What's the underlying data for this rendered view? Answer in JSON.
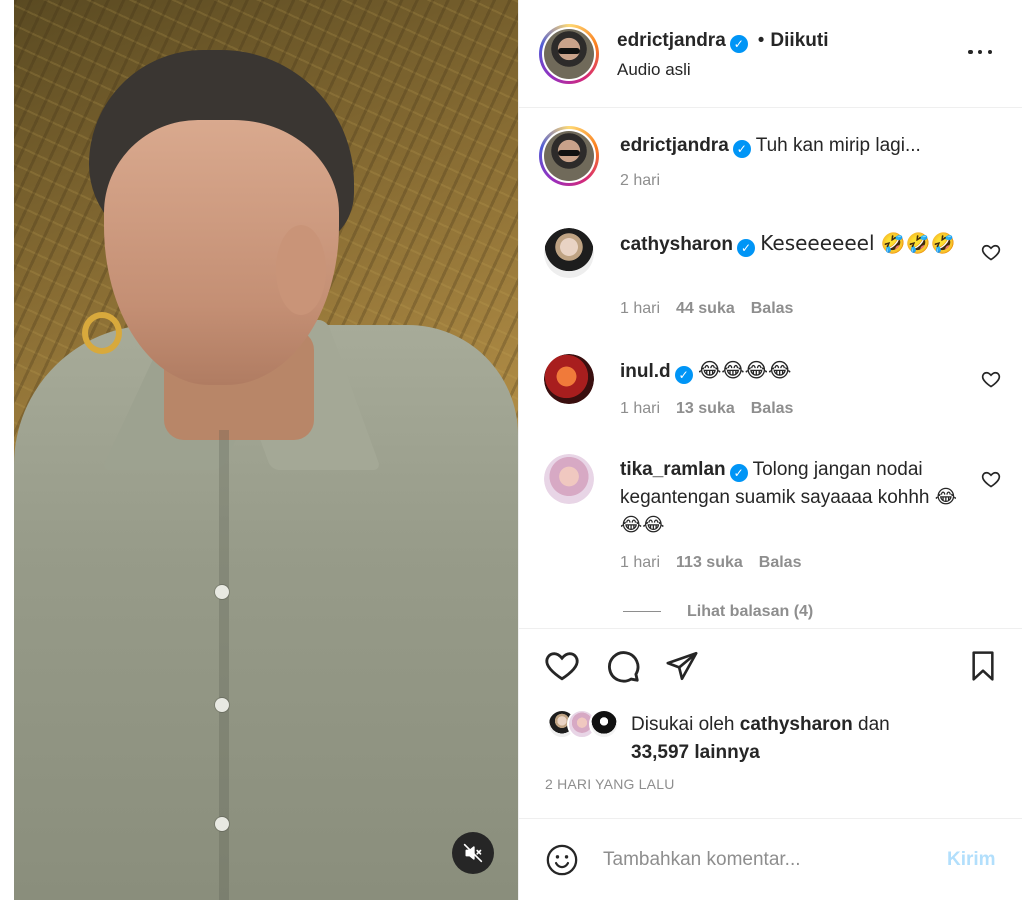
{
  "header": {
    "username": "edrictjandra",
    "dot": "•",
    "follow_status": "Diikuti",
    "subtitle": "Audio asli"
  },
  "caption": {
    "username": "edrictjandra",
    "text": "Tuh kan mirip lagi...",
    "time": "2 hari"
  },
  "comments": [
    {
      "username": "cathysharon",
      "text": "Keseeeeeel 🤣🤣🤣",
      "time": "1 hari",
      "likes": "44 suka",
      "reply": "Balas"
    },
    {
      "username": "inul.d",
      "text": "😂😂😂😂",
      "time": "1 hari",
      "likes": "13 suka",
      "reply": "Balas"
    },
    {
      "username": "tika_ramlan",
      "text": "Tolong jangan nodai kegantengan suamik sayaaaa kohhh 😂😂😂",
      "time": "1 hari",
      "likes": "113 suka",
      "reply": "Balas"
    }
  ],
  "view_replies": "Lihat balasan (4)",
  "likes": {
    "prefix": "Disukai oleh",
    "user": "cathysharon",
    "mid": "dan",
    "count": "33,597 lainnya"
  },
  "timestamp": "2 HARI YANG LALU",
  "composer": {
    "placeholder": "Tambahkan komentar...",
    "post_label": "Kirim"
  },
  "icons": {
    "verified": "verified-badge-icon",
    "more": "more-options-icon",
    "like": "heart-icon",
    "comment": "comment-icon",
    "share": "share-icon",
    "save": "bookmark-icon",
    "emoji": "emoji-icon",
    "mute": "audio-muted-icon"
  },
  "colors": {
    "verified": "#0095f6",
    "post_disabled": "#b2dffc",
    "secondary_text": "#8e8e8e"
  }
}
